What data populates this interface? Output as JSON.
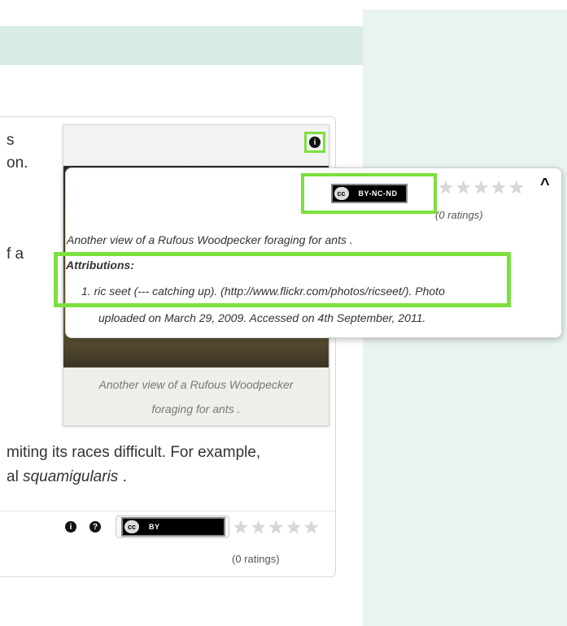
{
  "article": {
    "fragments": [
      "s",
      "on.",
      "f a"
    ],
    "body_line1": "miting its races difficult. For example,",
    "body_line2_prefix": "al ",
    "body_line2_italic": "squamigularis",
    "body_line2_suffix": " ."
  },
  "image": {
    "caption_line1": "Another view of a Rufous Woodpecker",
    "caption_line2": "foraging for ants ."
  },
  "popup": {
    "license_cc": "cc",
    "license_text": "BY-NC-ND",
    "ratings": "(0 ratings)",
    "description": "Another view of a Rufous Woodpecker foraging for ants .",
    "attributions_title": "Attributions:",
    "attribution_line1": "1.  ric seet (--- catching up). (http://www.flickr.com/photos/ricseet/). Photo",
    "attribution_line2": "uploaded on March 29, 2009. Accessed on 4th September, 2011."
  },
  "bottom": {
    "license_cc": "cc",
    "license_text": "BY",
    "ratings": "(0 ratings)"
  },
  "icons": {
    "info": "info-icon",
    "help": "help-icon",
    "star": "star-icon",
    "chevron": "chevron-up-icon"
  },
  "colors": {
    "highlight": "#7be03c",
    "panel": "#e9f3ef",
    "header": "#d9ece6"
  }
}
